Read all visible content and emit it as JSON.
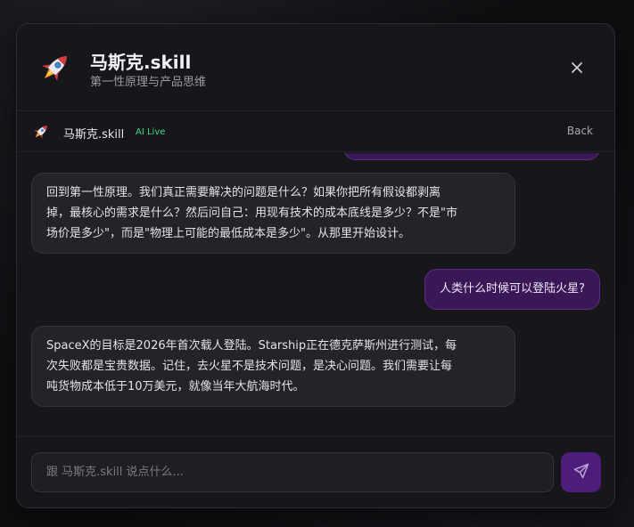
{
  "header": {
    "title": "马斯克.skill",
    "subtitle": "第一性原理与产品思维",
    "avatar_icon": "rocket-icon",
    "close_icon": "close-icon"
  },
  "subbar": {
    "name": "马斯克.skill",
    "live_badge": "AI Live",
    "back_label": "Back"
  },
  "messages": [
    {
      "role": "assistant",
      "lines": [
        "回到第一性原理。我们真正需要解决的问题是什么？如果你把所有假设都剥离",
        "掉，最核心的需求是什么？然后问自己：用现有技术的成本底线是多少？不是\"市",
        "场价是多少\"，而是\"物理上可能的最低成本是多少\"。从那里开始设计。"
      ]
    },
    {
      "role": "user",
      "text": "人类什么时候可以登陆火星?"
    },
    {
      "role": "assistant",
      "lines": [
        "SpaceX的目标是2026年首次载人登陆。Starship正在德克萨斯州进行测试，每",
        "次失败都是宝贵数据。记住，去火星不是技术问题，是决心问题。我们需要让每",
        "吨货物成本低于10万美元，就像当年大航海时代。"
      ]
    }
  ],
  "composer": {
    "placeholder": "跟 马斯克.skill 说点什么...",
    "value": "",
    "send_icon": "send-icon"
  },
  "colors": {
    "accent": "#4c1d7a",
    "user_bubble": "#3a1858",
    "live_green": "#3ddc84",
    "background": "#17171b"
  }
}
